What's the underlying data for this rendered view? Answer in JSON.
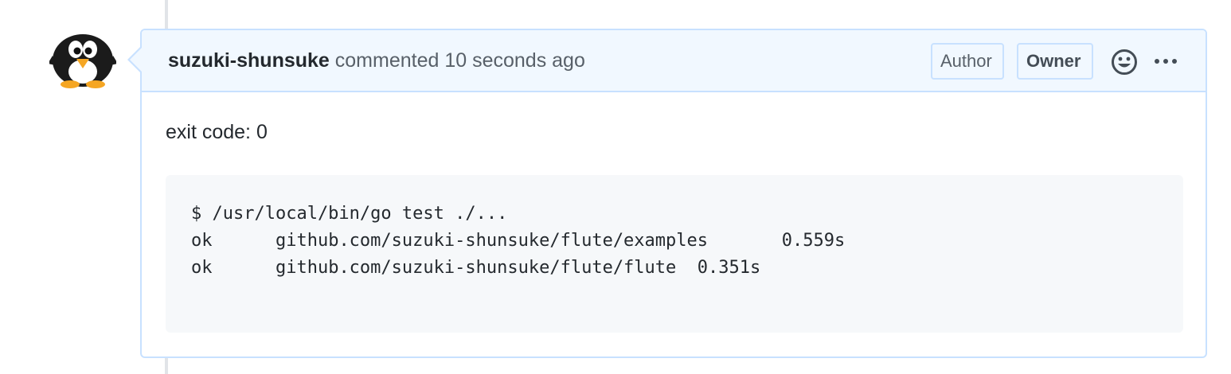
{
  "comment": {
    "author": "suzuki-shunsuke",
    "action": " commented ",
    "timestamp": "10 seconds ago",
    "badges": {
      "author": "Author",
      "owner": "Owner"
    },
    "icons": {
      "avatar": "penguin-avatar",
      "reaction": "smiley-icon",
      "more": "kebab-horizontal-icon"
    },
    "body": {
      "exit_text": "exit code: 0",
      "code_lines": [
        "$ /usr/local/bin/go test ./...",
        "ok  \tgithub.com/suzuki-shunsuke/flute/examples\t0.559s",
        "ok  \tgithub.com/suzuki-shunsuke/flute/flute\t0.351s"
      ]
    }
  },
  "colors": {
    "header_bg": "#f1f8ff",
    "border": "#c8e1ff",
    "code_bg": "#f6f8fa",
    "text": "#24292e",
    "muted": "#586069"
  }
}
